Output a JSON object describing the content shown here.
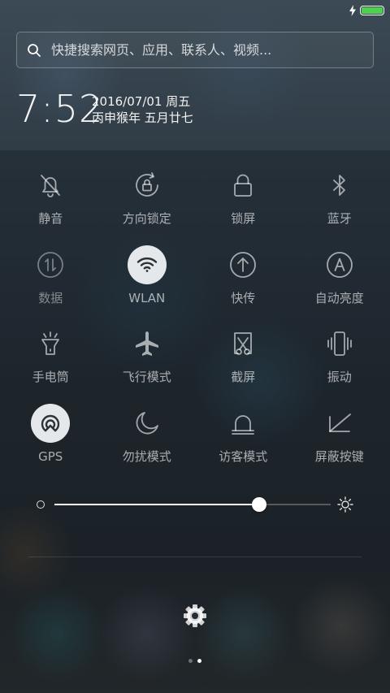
{
  "status_bar": {
    "battery_level": 1.0,
    "charging": true,
    "battery_color": "#4ed24e"
  },
  "search": {
    "placeholder": "快捷搜索网页、应用、联系人、视频...",
    "icon": "search-icon"
  },
  "clock": {
    "time": "7:52",
    "date": "2016/07/01 周五",
    "lunar": "丙申猴年 五月廿七"
  },
  "toggles": [
    {
      "label": "静音",
      "icon": "bell-off-icon",
      "active": false
    },
    {
      "label": "方向锁定",
      "icon": "rotation-lock-icon",
      "active": false
    },
    {
      "label": "锁屏",
      "icon": "lock-icon",
      "active": false
    },
    {
      "label": "蓝牙",
      "icon": "bluetooth-icon",
      "active": false
    },
    {
      "label": "数据",
      "icon": "mobile-data-icon",
      "active": false,
      "dimmed": true
    },
    {
      "label": "WLAN",
      "icon": "wifi-icon",
      "active": true
    },
    {
      "label": "快传",
      "icon": "upload-arrow-icon",
      "active": false
    },
    {
      "label": "自动亮度",
      "icon": "auto-brightness-icon",
      "active": false
    },
    {
      "label": "手电筒",
      "icon": "flashlight-icon",
      "active": false
    },
    {
      "label": "飞行模式",
      "icon": "airplane-icon",
      "active": false
    },
    {
      "label": "截屏",
      "icon": "screenshot-scissors-icon",
      "active": false
    },
    {
      "label": "振动",
      "icon": "vibrate-icon",
      "active": false
    },
    {
      "label": "GPS",
      "icon": "gps-icon",
      "active": true
    },
    {
      "label": "勿扰模式",
      "icon": "moon-icon",
      "active": false
    },
    {
      "label": "访客模式",
      "icon": "guest-mode-icon",
      "active": false
    },
    {
      "label": "屏蔽按键",
      "icon": "block-keys-icon",
      "active": false
    }
  ],
  "brightness": {
    "level": 0.74
  },
  "footer": {
    "settings_icon": "gear-icon",
    "pages": 2,
    "current_page": 2
  },
  "colors": {
    "active_toggle_bg": "#e4e8ea",
    "active_icon": "#2b3238"
  }
}
